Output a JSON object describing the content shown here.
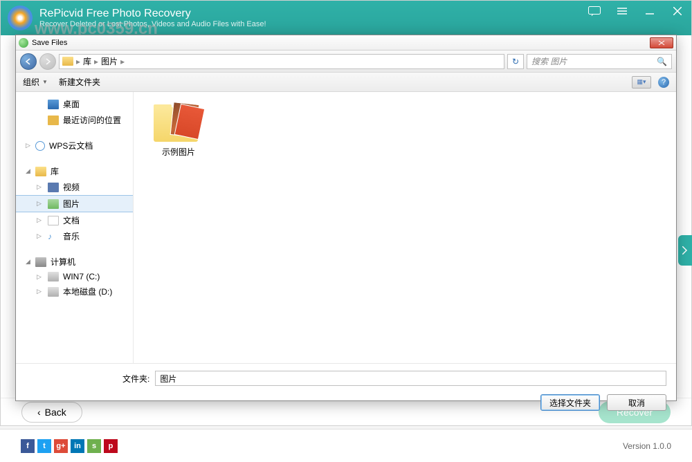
{
  "app": {
    "title": "RePicvid Free Photo Recovery",
    "subtitle": "Recover Deleted or Lost Photos, Videos and Audio Files with Ease!",
    "watermark": "www.pc0359.cn",
    "back_label": "Back",
    "recover_label": "Recover",
    "version_label": "Version 1.0.0"
  },
  "dialog": {
    "title": "Save Files",
    "breadcrumb": {
      "root": "库",
      "current": "图片"
    },
    "search_placeholder": "搜索 图片",
    "toolbar": {
      "organize": "组织",
      "new_folder": "新建文件夹"
    },
    "sidebar": {
      "desktop": "桌面",
      "recent": "最近访问的位置",
      "wps": "WPS云文档",
      "library": "库",
      "video": "视频",
      "image": "图片",
      "doc": "文档",
      "music": "音乐",
      "computer": "计算机",
      "drive_c": "WIN7 (C:)",
      "drive_d": "本地磁盘 (D:)"
    },
    "content": {
      "sample_folder": "示例图片"
    },
    "folder_label": "文件夹:",
    "folder_value": "图片",
    "select_button": "选择文件夹",
    "cancel_button": "取消"
  },
  "social": {
    "colors": {
      "fb": "#3b5998",
      "tw": "#1da1f2",
      "gp": "#dd4b39",
      "in": "#0077b5",
      "su": "#6fb04e",
      "pi": "#bd081c"
    }
  }
}
